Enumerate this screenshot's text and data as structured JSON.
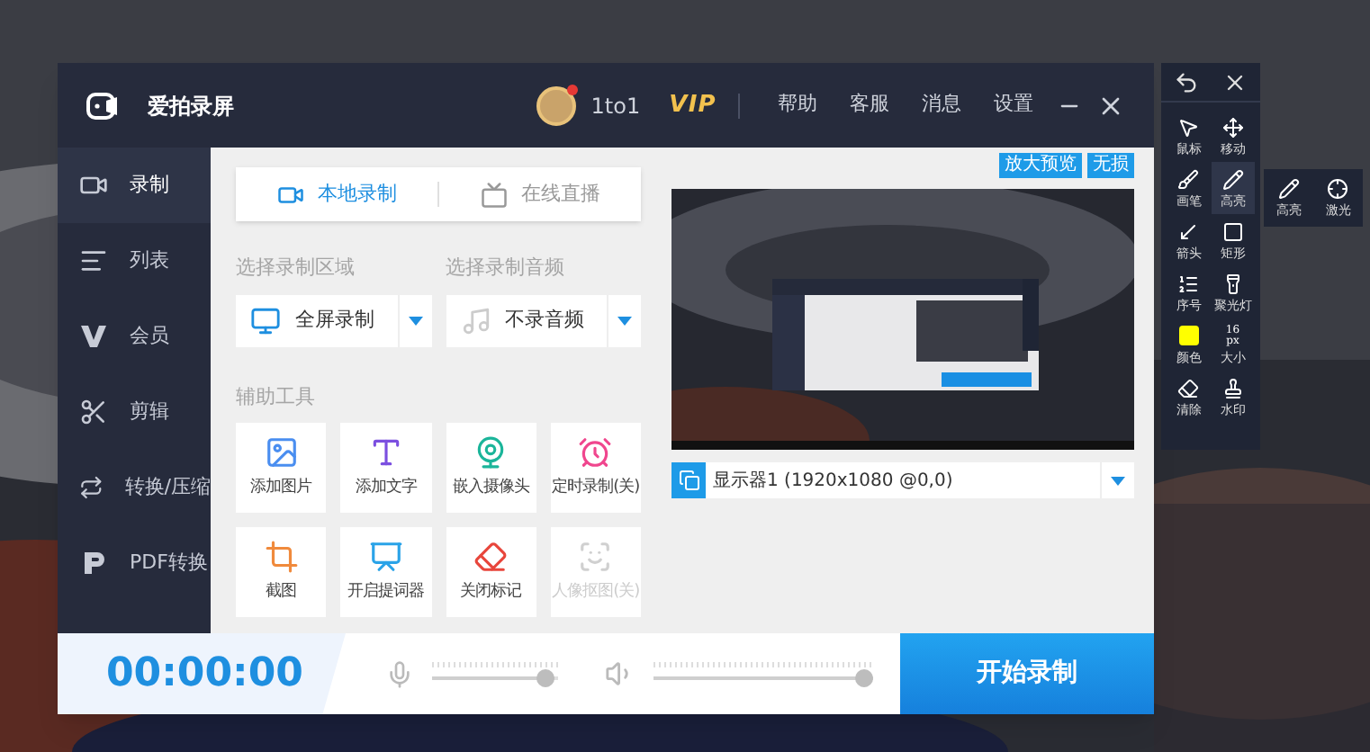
{
  "app": {
    "title": "爱拍录屏",
    "user": "1to1",
    "vip": "VIP",
    "menu": [
      "帮助",
      "客服",
      "消息",
      "设置"
    ]
  },
  "sidebar": [
    {
      "label": "录制",
      "selected": true
    },
    {
      "label": "列表",
      "selected": false
    },
    {
      "label": "会员",
      "selected": false
    },
    {
      "label": "剪辑",
      "selected": false
    },
    {
      "label": "转换/压缩",
      "selected": false
    },
    {
      "label": "PDF转换",
      "selected": false
    }
  ],
  "mode_tabs": [
    {
      "label": "本地录制",
      "selected": true
    },
    {
      "label": "在线直播",
      "selected": false
    }
  ],
  "area": {
    "label": "选择录制区域",
    "value": "全屏录制"
  },
  "audio": {
    "label": "选择录制音频",
    "value": "不录音频"
  },
  "tools_title": "辅助工具",
  "tools": [
    {
      "label": "添加图片",
      "disabled": false
    },
    {
      "label": "添加文字",
      "disabled": false
    },
    {
      "label": "嵌入摄像头",
      "disabled": false
    },
    {
      "label": "定时录制(关)",
      "disabled": false
    },
    {
      "label": "截图",
      "disabled": false
    },
    {
      "label": "开启提词器",
      "disabled": false
    },
    {
      "label": "关闭标记",
      "disabled": false
    },
    {
      "label": "人像抠图(关)",
      "disabled": true
    }
  ],
  "preview": {
    "buttons": [
      "放大预览",
      "无损"
    ],
    "display": "显示器1 (1920x1080 @0,0)"
  },
  "bottom": {
    "timer": "00:00:00",
    "mic": {
      "level": 0.97
    },
    "speaker": {
      "level": 1
    },
    "start": "开始录制"
  },
  "annotate": {
    "tools": [
      {
        "label": "鼠标",
        "kind": "icon",
        "selected": false
      },
      {
        "label": "移动",
        "kind": "icon",
        "selected": false
      },
      {
        "label": "画笔",
        "kind": "icon",
        "selected": false
      },
      {
        "label": "高亮",
        "kind": "icon",
        "selected": true
      },
      {
        "label": "箭头",
        "kind": "icon",
        "selected": false
      },
      {
        "label": "矩形",
        "kind": "icon",
        "selected": false
      },
      {
        "label": "序号",
        "kind": "icon",
        "selected": false
      },
      {
        "label": "聚光灯",
        "kind": "icon",
        "selected": false
      },
      {
        "label": "颜色",
        "kind": "color",
        "color": "#ffff00",
        "selected": false
      },
      {
        "label": "大小",
        "kind": "size",
        "selected": false
      },
      {
        "label": "清除",
        "kind": "icon",
        "selected": false
      },
      {
        "label": "水印",
        "kind": "icon",
        "selected": false
      }
    ],
    "pen_size": {
      "size": "16",
      "unit": "px"
    },
    "flyout": [
      {
        "label": "高亮"
      },
      {
        "label": "激光"
      }
    ]
  }
}
